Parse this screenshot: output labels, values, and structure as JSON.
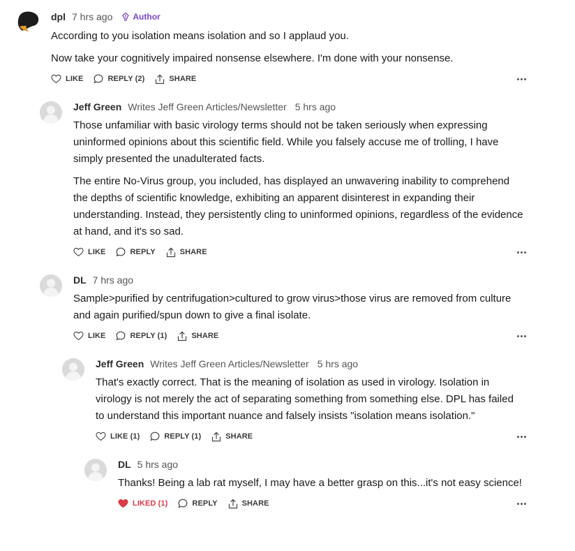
{
  "badge_label": "Author",
  "actions": {
    "like": "LIKE",
    "share": "SHARE"
  },
  "comments": [
    {
      "author": "dpl",
      "time": "7 hrs ago",
      "paragraphs": [
        "According to you isolation means isolation and so I applaud you.",
        "Now take your cognitively impaired nonsense elsewhere. I'm done with your nonsense."
      ],
      "like_label": "LIKE",
      "reply_label": "REPLY (2)"
    },
    {
      "author": "Jeff Green",
      "description": "Writes Jeff Green Articles/Newsletter",
      "time": "5 hrs ago",
      "paragraphs": [
        "Those unfamiliar with basic virology terms should not be taken seriously when expressing uninformed opinions about this scientific field. While you falsely accuse me of trolling, I have simply presented the unadulterated facts.",
        "The entire No-Virus group, you included, has displayed an unwavering inability to comprehend the depths of scientific knowledge, exhibiting an apparent disinterest in expanding their understanding. Instead, they persistently cling to uninformed opinions, regardless of the evidence at hand, and it's so sad."
      ],
      "like_label": "LIKE",
      "reply_label": "REPLY"
    },
    {
      "author": "DL",
      "time": "7 hrs ago",
      "paragraphs": [
        "Sample>purified by centrifugation>cultured to grow virus>those virus are removed from culture and again purified/spun down to give a final isolate."
      ],
      "like_label": "LIKE",
      "reply_label": "REPLY (1)"
    },
    {
      "author": "Jeff Green",
      "description": "Writes Jeff Green Articles/Newsletter",
      "time": "5 hrs ago",
      "paragraphs": [
        "That's exactly correct. That is the meaning of isolation as used in virology. Isolation in virology is not merely the act of separating something from something else. DPL has failed to understand this important nuance and falsely insists \"isolation means isolation.\""
      ],
      "like_label": "LIKE (1)",
      "reply_label": "REPLY (1)"
    },
    {
      "author": "DL",
      "time": "5 hrs ago",
      "paragraphs": [
        "Thanks! Being a lab rat myself, I may have a better grasp on this...it's not easy science!"
      ],
      "like_label": "LIKED (1)",
      "reply_label": "REPLY"
    }
  ],
  "colors": {
    "author_badge": "#7a44c6",
    "liked": "#d83b49"
  }
}
